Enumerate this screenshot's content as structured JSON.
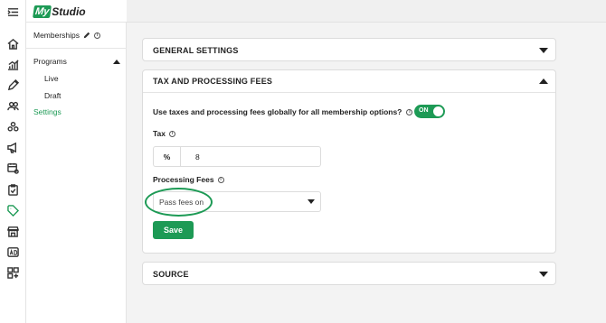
{
  "logo": {
    "my": "My",
    "studio": "Studio"
  },
  "rail": {
    "icons": [
      "menu-icon",
      "home-icon",
      "chart-icon",
      "pencil-icon",
      "users-icon",
      "groups-icon",
      "megaphone-icon",
      "calendar-settings-icon",
      "clipboard-check-icon",
      "tag-icon",
      "store-icon",
      "ad-icon",
      "apps-icon"
    ]
  },
  "sidebar": {
    "title": "Memberships",
    "programs": "Programs",
    "live": "Live",
    "draft": "Draft",
    "settings": "Settings"
  },
  "panels": {
    "general": "GENERAL SETTINGS",
    "tax": "TAX AND PROCESSING FEES",
    "source": "SOURCE"
  },
  "tax_section": {
    "question": "Use taxes and processing fees globally for all membership options?",
    "toggle_label": "ON",
    "tax_label": "Tax",
    "tax_unit": "%",
    "tax_value": "8",
    "fees_label": "Processing Fees",
    "fees_selected": "Pass fees on",
    "save_label": "Save"
  },
  "colors": {
    "accent": "#1d9a55"
  }
}
